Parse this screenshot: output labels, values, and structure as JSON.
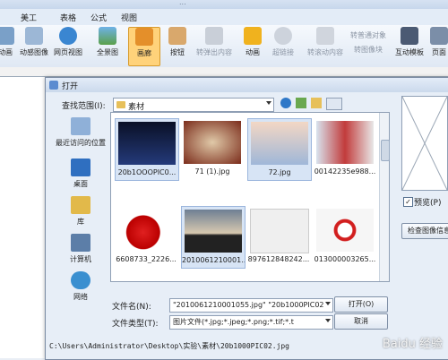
{
  "app": {
    "title": "...",
    "menu": [
      "美工",
      "表格",
      "公式",
      "视图"
    ],
    "ribbon": [
      {
        "label": "动画",
        "icon": "film-icon"
      },
      {
        "label": "动感图像",
        "icon": "dynamic-image-icon"
      },
      {
        "label": "网页视图",
        "icon": "web-view-icon"
      },
      {
        "label": "全景图",
        "icon": "panorama-icon"
      },
      {
        "label": "画廊",
        "icon": "gallery-icon"
      },
      {
        "label": "按钮",
        "icon": "button-icon"
      },
      {
        "label": "转弹出内容",
        "icon": "popup-icon"
      },
      {
        "label": "动画",
        "icon": "star-icon"
      },
      {
        "label": "超链接",
        "icon": "hyperlink-icon"
      },
      {
        "label": "转普通对象",
        "icon": "convert-object-icon"
      },
      {
        "label": "转图像块",
        "icon": "convert-image-icon"
      },
      {
        "label": "转滚动内容",
        "icon": "scroll-content-icon"
      },
      {
        "label": "互动模板",
        "icon": "template-icon"
      },
      {
        "label": "页面",
        "icon": "page-icon"
      }
    ]
  },
  "dialog": {
    "title": "打开",
    "look_in_label": "查找范围(I):",
    "look_in_value": "素材",
    "places": [
      {
        "label": "最近访问的位置",
        "icon": "recent-places-icon"
      },
      {
        "label": "桌面",
        "icon": "desktop-icon"
      },
      {
        "label": "库",
        "icon": "library-icon"
      },
      {
        "label": "计算机",
        "icon": "computer-icon"
      },
      {
        "label": "网络",
        "icon": "network-icon"
      }
    ],
    "files": [
      {
        "name": "20b1OOOPIC0...",
        "icon": "night-sky-thumbnail"
      },
      {
        "name": "71 (1).jpg",
        "icon": "food-thumbnail"
      },
      {
        "name": "72.jpg",
        "icon": "baby-thumbnail"
      },
      {
        "name": "00142235e988...",
        "icon": "people-thumbnail"
      },
      {
        "name": "6608733_2226...",
        "icon": "apple-thumbnail"
      },
      {
        "name": "2010061210001...",
        "icon": "couple-sunset-thumbnail"
      },
      {
        "name": "897612848242...",
        "icon": "postcard-thumbnail"
      },
      {
        "name": "013000003265...",
        "icon": "red-ribbon-thumbnail"
      }
    ],
    "filename_label": "文件名(N):",
    "filename_value": "\"2010061210001055.jpg\" \"20b1000PIC02.",
    "filetype_label": "文件类型(T):",
    "filetype_value": "图片文件(*.jpg;*.jpeg;*.png;*.tif;*.t",
    "open_button": "打开(O)",
    "cancel_button": "取消",
    "preview_label": "预览(P)",
    "preview_checked": true,
    "check_info_button": "检查图像信息",
    "path": "C:\\Users\\Administrator\\Desktop\\实验\\素材\\20b1000PIC02.jpg"
  },
  "watermark": "Baidu 经验"
}
